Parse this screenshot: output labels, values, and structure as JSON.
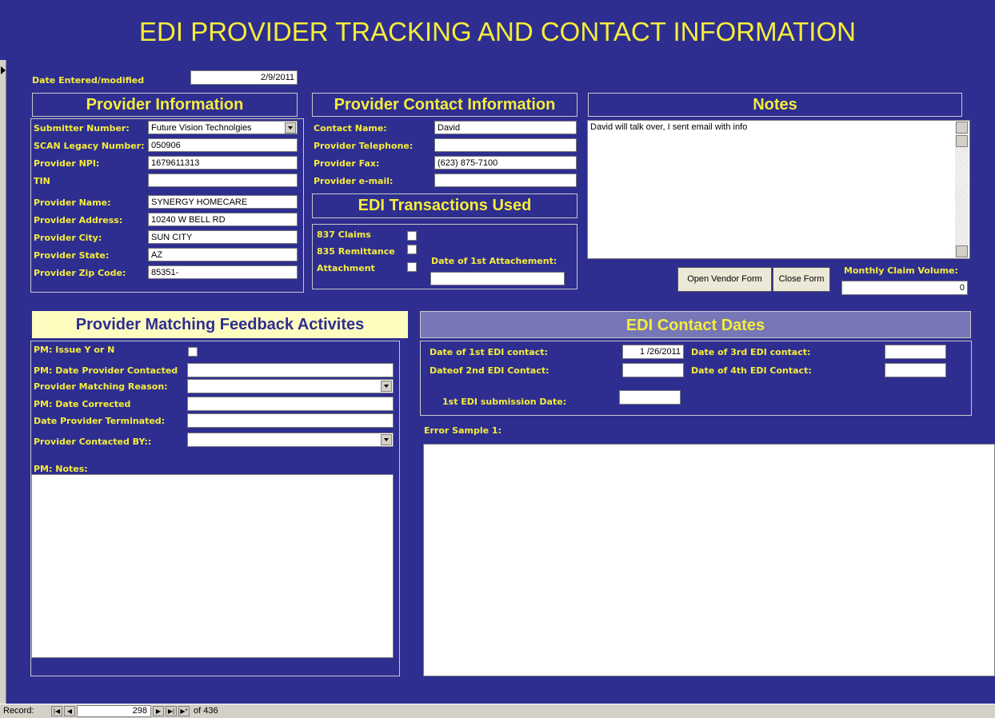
{
  "form_title": "EDI PROVIDER TRACKING AND CONTACT INFORMATION",
  "date_entered": {
    "label": "Date Entered/modified",
    "value": "2/9/2011"
  },
  "provider_info": {
    "header": "Provider Information",
    "fields": [
      {
        "label": "Submitter Number:",
        "value": "Future Vision Technolgies"
      },
      {
        "label": "SCAN Legacy Number:",
        "value": "050906"
      },
      {
        "label": "Provider NPI:",
        "value": "1679611313"
      },
      {
        "label": "TIN",
        "value": ""
      },
      {
        "label": "Provider Name:",
        "value": "SYNERGY HOMECARE"
      },
      {
        "label": "Provider Address:",
        "value": "10240 W BELL RD"
      },
      {
        "label": "Provider City:",
        "value": "SUN CITY"
      },
      {
        "label": "Provider State:",
        "value": "AZ"
      },
      {
        "label": "Provider Zip Code:",
        "value": "85351-"
      }
    ]
  },
  "contact_info": {
    "header": "Provider Contact Information",
    "fields": [
      {
        "label": "Contact Name:",
        "value": "David"
      },
      {
        "label": "Provider Telephone:",
        "value": ""
      },
      {
        "label": "Provider Fax:",
        "value": "(623) 875-7100"
      },
      {
        "label": "Provider e-mail:",
        "value": ""
      }
    ]
  },
  "transactions": {
    "header": "EDI Transactions Used",
    "items": [
      "837 Claims",
      "835 Remittance",
      "Attachment"
    ],
    "attachment_date_label": "Date of 1st Attachement:",
    "attachment_date_value": ""
  },
  "notes": {
    "header": "Notes",
    "text": "David will talk over, I sent email with info"
  },
  "buttons": {
    "open_vendor": "Open Vendor Form",
    "close_form": "Close Form"
  },
  "monthly_claim_volume": {
    "label": "Monthly Claim Volume:",
    "value": "0"
  },
  "pm": {
    "header": "Provider Matching Feedback Activites",
    "issue_label": "PM: Issue Y or N",
    "date_contacted_label": "PM: Date Provider Contacted",
    "reason_label": "Provider Matching Reason:",
    "date_corrected_label": "PM: Date Corrected",
    "date_terminated_label": "Date Provider Terminated:",
    "contacted_by_label": "Provider Contacted BY::",
    "notes_label": "PM: Notes:"
  },
  "edi_dates": {
    "header": "EDI Contact Dates",
    "first_label": "Date of 1st EDI contact:",
    "first_value": "1 /26/2011",
    "second_label": "Dateof  2nd EDI Contact:",
    "second_value": "",
    "third_label": "Date of  3rd EDI contact:",
    "third_value": "",
    "fourth_label": "Date of 4th EDI Contact:",
    "fourth_value": "",
    "submission_label": "1st EDI submission Date:",
    "submission_value": ""
  },
  "error_sample": {
    "label": "Error Sample 1:"
  },
  "record_nav": {
    "label": "Record:",
    "current": "298",
    "of_label": "of  436"
  }
}
